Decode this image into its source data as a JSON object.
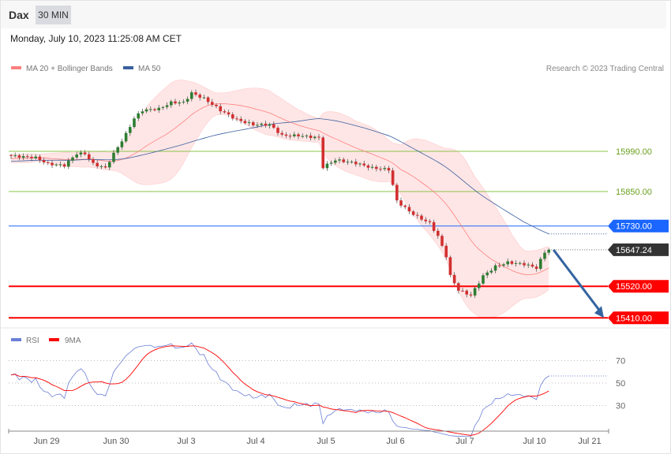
{
  "header": {
    "symbol": "Dax",
    "timeframe": "30 MIN",
    "datetime": "Monday, July 10, 2023 11:25:08 AM CET"
  },
  "colors": {
    "ma20": "#ff7f7f",
    "ma50": "#3a5f9e",
    "band": "#ffe3e3",
    "bull": "#2e7d32",
    "bear": "#d32f2f",
    "green_level": "#8bc34a",
    "blue_level": "#1a66ff",
    "red_level": "#ff0000",
    "current": "#333333",
    "arrow": "#3464a0",
    "rsi": "#6b7fd6",
    "rsi_ma": "#ff0000"
  },
  "chart_data": [
    {
      "type": "candlestick",
      "legend": [
        {
          "name": "MA 20 + Bollinger Bands"
        },
        {
          "name": "MA 50"
        }
      ],
      "copyright": "Research © 2023 Trading Central",
      "keypoints": [
        [
          0,
          15974
        ],
        [
          6,
          15968
        ],
        [
          9,
          15946
        ],
        [
          13,
          15941
        ],
        [
          16,
          15982
        ],
        [
          18,
          15982
        ],
        [
          20,
          15946
        ],
        [
          23,
          15932
        ],
        [
          25,
          15982
        ],
        [
          28,
          16050
        ],
        [
          30,
          16105
        ],
        [
          32,
          16133
        ],
        [
          36,
          16138
        ],
        [
          39,
          16160
        ],
        [
          42,
          16160
        ],
        [
          44,
          16193
        ],
        [
          47,
          16174
        ],
        [
          51,
          16133
        ],
        [
          55,
          16100
        ],
        [
          59,
          16083
        ],
        [
          63,
          16083
        ],
        [
          66,
          16045
        ],
        [
          70,
          16045
        ],
        [
          75,
          16037
        ],
        [
          76,
          15935
        ],
        [
          79,
          15960
        ],
        [
          84,
          15949
        ],
        [
          88,
          15932
        ],
        [
          92,
          15927
        ],
        [
          94,
          15817
        ],
        [
          97,
          15781
        ],
        [
          99,
          15762
        ],
        [
          102,
          15740
        ],
        [
          104,
          15694
        ],
        [
          106,
          15625
        ],
        [
          107,
          15556
        ],
        [
          109,
          15507
        ],
        [
          112,
          15488
        ],
        [
          115,
          15556
        ],
        [
          118,
          15589
        ],
        [
          121,
          15603
        ],
        [
          125,
          15597
        ],
        [
          128,
          15584
        ],
        [
          130,
          15639
        ],
        [
          131,
          15647
        ]
      ],
      "levels": [
        {
          "value": 15990,
          "label": "15990.00",
          "kind": "green"
        },
        {
          "value": 15850,
          "label": "15850.00",
          "kind": "green"
        },
        {
          "value": 15730,
          "label": "15730.00",
          "kind": "blue"
        },
        {
          "value": 15647.24,
          "label": "15647.24",
          "kind": "current"
        },
        {
          "value": 15520,
          "label": "15520.00",
          "kind": "red"
        },
        {
          "value": 15410,
          "label": "15410.00",
          "kind": "red"
        }
      ],
      "forecast_target": 15410,
      "x_ticks": [
        "Jun 29",
        "Jun 30",
        "Jul 3",
        "Jul 4",
        "Jul 5",
        "Jul 6",
        "Jul 7",
        "Jul 10",
        "Jul 21"
      ]
    },
    {
      "type": "line",
      "legend": [
        {
          "name": "RSI"
        },
        {
          "name": "9MA"
        }
      ],
      "y_ticks": [
        "70",
        "50",
        "30"
      ],
      "ylim": [
        0,
        100
      ]
    }
  ]
}
